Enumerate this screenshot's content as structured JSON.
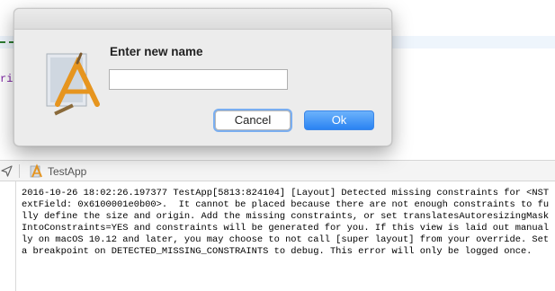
{
  "editor": {
    "visible_fragment": "rin"
  },
  "debug_bar": {
    "location_icon": "location-arrow-icon",
    "app_icon": "xcode-app-icon",
    "target_label": "TestApp"
  },
  "console": {
    "log_text": "2016-10-26 18:02:26.197377 TestApp[5813:824104] [Layout] Detected missing constraints for <NSTextField: 0x6100001e0b00>.  It cannot be placed because there are not enough constraints to fully define the size and origin. Add the missing constraints, or set translatesAutoresizingMaskIntoConstraints=YES and constraints will be generated for you. If this view is laid out manually on macOS 10.12 and later, you may choose to not call [super layout] from your override. Set a breakpoint on DETECTED_MISSING_CONSTRAINTS to debug. This error will only be logged once."
  },
  "dialog": {
    "icon": "xcode-app-icon",
    "title": "Enter new name",
    "name_field": {
      "value": "",
      "placeholder": ""
    },
    "cancel_label": "Cancel",
    "ok_label": "Ok",
    "accent_color": "#2a83f2"
  }
}
